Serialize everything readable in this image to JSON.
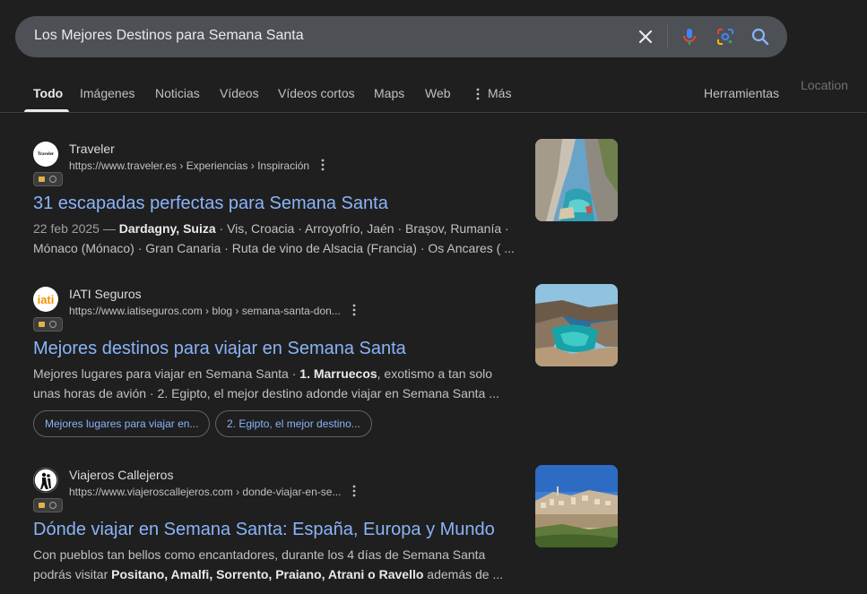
{
  "search": {
    "query": "Los Mejores Destinos para Semana Santa",
    "icons": [
      "close-icon",
      "mic-icon",
      "lens-icon",
      "search-icon"
    ]
  },
  "tabs": [
    {
      "label": "Todo",
      "active": true
    },
    {
      "label": "Imágenes"
    },
    {
      "label": "Noticias"
    },
    {
      "label": "Vídeos"
    },
    {
      "label": "Vídeos cortos"
    },
    {
      "label": "Maps"
    },
    {
      "label": "Web"
    },
    {
      "label": "Más"
    }
  ],
  "toolbar": {
    "tools_label": "Herramientas",
    "location_label": "Location"
  },
  "results": [
    {
      "site_name": "Traveler",
      "favicon_text": "Traveler",
      "url": "https://www.traveler.es › Experiencias › Inspiración",
      "title": "31 escapadas perfectas para Semana Santa",
      "date": "22 feb 2025 —",
      "snippet_bold": "Dardagny, Suiza",
      "snippet_line1_rest": " · Vis, Croacia · Arroyofrío, Jaén · Brașov, Rumanía ·",
      "snippet_line2": "Mónaco (Mónaco) · Gran Canaria · Ruta de vino de Alsacia (Francia) · Os Ancares ( ...",
      "thumb": "cliff-cove-photo"
    },
    {
      "site_name": "IATI Seguros",
      "favicon_text": "iati",
      "url": "https://www.iatiseguros.com › blog › semana-santa-don...",
      "title": "Mejores destinos para viajar en Semana Santa",
      "snippet_pre": "Mejores lugares para viajar en Semana Santa · ",
      "snippet_bold": "1. Marruecos",
      "snippet_post": ", exotismo a tan solo",
      "snippet_line2": "unas horas de avión · 2. Egipto, el mejor destino adonde viajar en Semana Santa ...",
      "chips": [
        "Mejores lugares para viajar en...",
        "2. Egipto, el mejor destino..."
      ],
      "thumb": "turquoise-bay-photo"
    },
    {
      "site_name": "Viajeros Callejeros",
      "url": "https://www.viajeroscallejeros.com › donde-viajar-en-se...",
      "title": "Dónde viajar en Semana Santa: España, Europa y Mundo",
      "snippet_line1": "Con pueblos tan bellos como encantadores, durante los 4 días de Semana Santa",
      "snippet_pre2": "podrás visitar ",
      "snippet_bold": "Positano, Amalfi, Sorrento, Praiano, Atrani o Ravello",
      "snippet_post2": " además de ...",
      "thumb": "hill-town-photo"
    }
  ]
}
